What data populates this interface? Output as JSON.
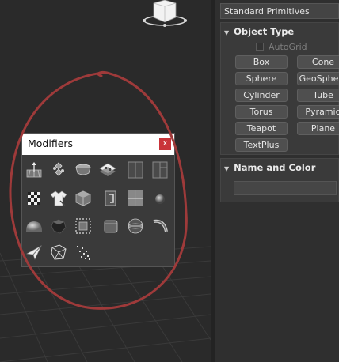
{
  "panel": {
    "dropdown_label": "Standard Primitives",
    "object_type": {
      "header": "Object Type",
      "autogrid_label": "AutoGrid",
      "buttons": [
        "Box",
        "Cone",
        "Sphere",
        "GeoSphere",
        "Cylinder",
        "Tube",
        "Torus",
        "Pyramid",
        "Teapot",
        "Plane",
        "TextPlus"
      ]
    },
    "name_and_color": {
      "header": "Name and Color",
      "name_value": ""
    }
  },
  "modifiers_dialog": {
    "title": "Modifiers",
    "close_label": "x",
    "icons": [
      "ffd-grid-icon",
      "twist-icon",
      "taper-icon",
      "shell-icon",
      "panel-slot-icon",
      "panel-slot-2-icon",
      "checker-icon",
      "cloth-icon",
      "cube-icon",
      "page-icon",
      "split-icon",
      "sphere-small-icon",
      "dome-icon",
      "faceted-blob-icon",
      "dotted-frame-icon",
      "rounded-cube-icon",
      "globe-icon",
      "curve-icon",
      "paper-plane-icon",
      "crumple-icon",
      "particles-icon"
    ]
  },
  "colors": {
    "annotation": "#9e3a3a",
    "close_button": "#c9343a",
    "divider_accent": "#6b5a1f"
  }
}
